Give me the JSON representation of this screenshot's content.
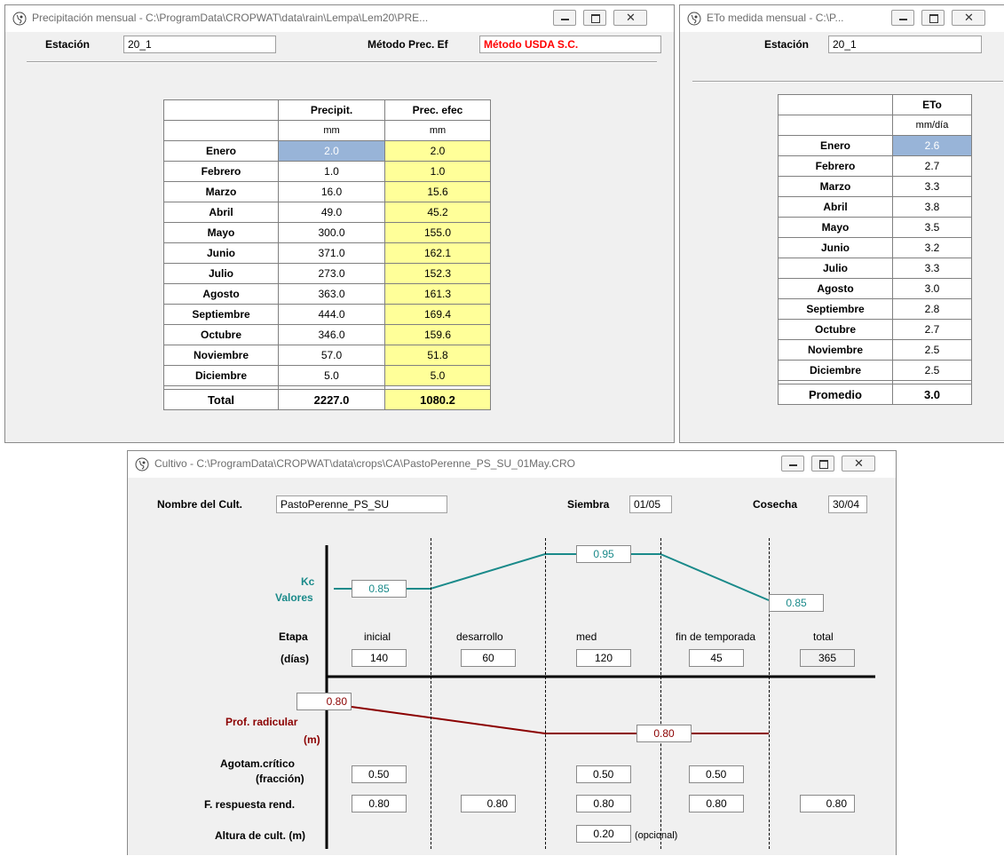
{
  "precip_window": {
    "title": "Precipitación mensual - C:\\ProgramData\\CROPWAT\\data\\rain\\Lempa\\Lem20\\PRE...",
    "station_label": "Estación",
    "station_value": "20_1",
    "method_label": "Método Prec. Ef",
    "method_value": "Método USDA S.C.",
    "col_precip": "Precipit.",
    "col_eff": "Prec. efec",
    "unit_precip": "mm",
    "unit_eff": "mm",
    "rows": [
      {
        "month": "Enero",
        "precip": "2.0",
        "eff": "2.0"
      },
      {
        "month": "Febrero",
        "precip": "1.0",
        "eff": "1.0"
      },
      {
        "month": "Marzo",
        "precip": "16.0",
        "eff": "15.6"
      },
      {
        "month": "Abril",
        "precip": "49.0",
        "eff": "45.2"
      },
      {
        "month": "Mayo",
        "precip": "300.0",
        "eff": "155.0"
      },
      {
        "month": "Junio",
        "precip": "371.0",
        "eff": "162.1"
      },
      {
        "month": "Julio",
        "precip": "273.0",
        "eff": "152.3"
      },
      {
        "month": "Agosto",
        "precip": "363.0",
        "eff": "161.3"
      },
      {
        "month": "Septiembre",
        "precip": "444.0",
        "eff": "169.4"
      },
      {
        "month": "Octubre",
        "precip": "346.0",
        "eff": "159.6"
      },
      {
        "month": "Noviembre",
        "precip": "57.0",
        "eff": "51.8"
      },
      {
        "month": "Diciembre",
        "precip": "5.0",
        "eff": "5.0"
      }
    ],
    "total_label": "Total",
    "total_precip": "2227.0",
    "total_eff": "1080.2"
  },
  "eto_window": {
    "title": "ETo medida mensual - C:\\P...",
    "station_label": "Estación",
    "station_value": "20_1",
    "col_eto": "ETo",
    "unit_eto": "mm/día",
    "rows": [
      {
        "month": "Enero",
        "eto": "2.6"
      },
      {
        "month": "Febrero",
        "eto": "2.7"
      },
      {
        "month": "Marzo",
        "eto": "3.3"
      },
      {
        "month": "Abril",
        "eto": "3.8"
      },
      {
        "month": "Mayo",
        "eto": "3.5"
      },
      {
        "month": "Junio",
        "eto": "3.2"
      },
      {
        "month": "Julio",
        "eto": "3.3"
      },
      {
        "month": "Agosto",
        "eto": "3.0"
      },
      {
        "month": "Septiembre",
        "eto": "2.8"
      },
      {
        "month": "Octubre",
        "eto": "2.7"
      },
      {
        "month": "Noviembre",
        "eto": "2.5"
      },
      {
        "month": "Diciembre",
        "eto": "2.5"
      }
    ],
    "avg_label": "Promedio",
    "avg_value": "3.0"
  },
  "crop_window": {
    "title": "Cultivo - C:\\ProgramData\\CROPWAT\\data\\crops\\CA\\PastoPerenne_PS_SU_01May.CRO",
    "crop_name_label": "Nombre del Cult.",
    "crop_name_value": "PastoPerenne_PS_SU",
    "sowing_label": "Siembra",
    "sowing_value": "01/05",
    "harvest_label": "Cosecha",
    "harvest_value": "30/04",
    "kc_label_1": "Kc",
    "kc_label_2": "Valores",
    "kc_initial": "0.85",
    "kc_mid": "0.95",
    "kc_end": "0.85",
    "stage_label": "Etapa",
    "days_label": "(días)",
    "stage_names": [
      "inicial",
      "desarrollo",
      "med",
      "fin de temporada",
      "total"
    ],
    "stage_days": [
      "140",
      "60",
      "120",
      "45",
      "365"
    ],
    "root_label_1": "Prof. radicular",
    "root_label_2": "(m)",
    "root_initial": "0.80",
    "root_max": "0.80",
    "depletion_label_1": "Agotam.crítico",
    "depletion_label_2": "(fracción)",
    "depletion_values": [
      "0.50",
      "0.50",
      "0.50"
    ],
    "yield_label": "F. respuesta rend.",
    "yield_values": [
      "0.80",
      "0.80",
      "0.80",
      "0.80",
      "0.80"
    ],
    "height_label": "Altura de cult. (m)",
    "height_value": "0.20",
    "height_note": "(opcional)"
  },
  "colors": {
    "kc_line": "#1a8a8a",
    "root_line": "#8b0000",
    "eff_cell": "#ffff99",
    "selected_cell": "#98b4d8",
    "method_text": "#ff0000"
  },
  "icons": [
    "cropwat-app-icon",
    "minimize-icon",
    "maximize-icon",
    "close-icon"
  ]
}
